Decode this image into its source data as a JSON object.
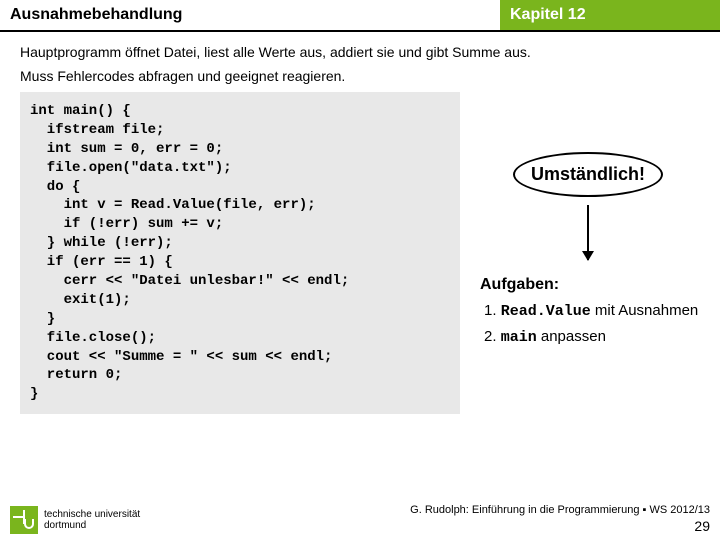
{
  "header": {
    "left": "Ausnahmebehandlung",
    "right": "Kapitel 12"
  },
  "content": {
    "line1": "Hauptprogramm öffnet Datei, liest alle Werte aus, addiert sie und gibt Summe aus.",
    "line2": "Muss Fehlercodes abfragen und geeignet reagieren."
  },
  "code": "int main() {\n  ifstream file;\n  int sum = 0, err = 0;\n  file.open(\"data.txt\");\n  do {\n    int v = Read.Value(file, err);\n    if (!err) sum += v;\n  } while (!err);\n  if (err == 1) {\n    cerr << \"Datei unlesbar!\" << endl;\n    exit(1);\n  }\n  file.close();\n  cout << \"Summe = \" << sum << endl;\n  return 0;\n}",
  "bubble": "Umständlich!",
  "tasks": {
    "title": "Aufgaben:",
    "t1_num": "1. ",
    "t1_code": "Read.Value",
    "t1_rest": " mit Ausnahmen",
    "t2_num": "2. ",
    "t2_code": "main",
    "t2_rest": " anpassen"
  },
  "footer": {
    "uni1": "technische universität",
    "uni2": "dortmund",
    "credit": "G. Rudolph: Einführung in die Programmierung ▪ WS 2012/13",
    "slide": "29"
  }
}
